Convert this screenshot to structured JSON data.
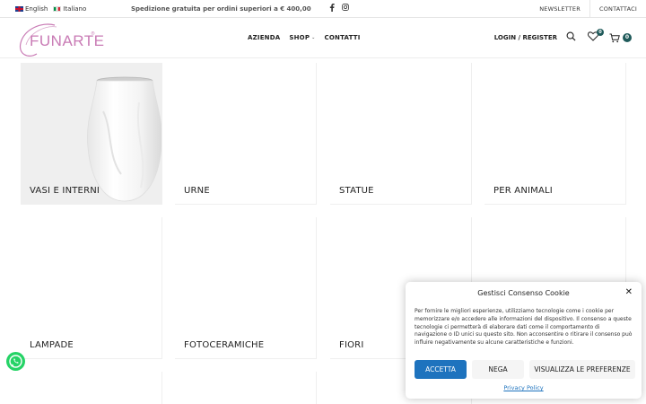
{
  "topbar": {
    "languages": [
      {
        "label": "English",
        "flag": "uk-flag-icon"
      },
      {
        "label": "Italiano",
        "flag": "italy-flag-icon"
      }
    ],
    "shipping_text": "Spedizione gratuita per ordini superiori a € 400,00",
    "social": [
      "facebook-icon",
      "instagram-icon"
    ],
    "links": [
      "NEWSLETTER",
      "CONTATTACI"
    ]
  },
  "header": {
    "logo_text": "FUNARTE",
    "logo_mark": "®",
    "nav": [
      {
        "label": "AZIENDA",
        "dropdown": false
      },
      {
        "label": "SHOP",
        "dropdown": true
      },
      {
        "label": "CONTATTI",
        "dropdown": false
      }
    ],
    "login_label": "LOGIN / REGISTER",
    "wishlist_count": "0",
    "cart_count": "0",
    "accent_color": "#1f5a5a",
    "logo_color": "#c97bb5"
  },
  "categories": [
    {
      "label": "VASI E INTERNI"
    },
    {
      "label": "URNE"
    },
    {
      "label": "STATUE"
    },
    {
      "label": "PER ANIMALI"
    },
    {
      "label": "LAMPADE"
    },
    {
      "label": "FOTOCERAMICHE"
    },
    {
      "label": "FIORI"
    },
    {
      "label": ""
    }
  ],
  "cookie": {
    "title": "Gestisci Consenso Cookie",
    "text": "Per fornire le migliori esperienze, utilizziamo tecnologie come i cookie per memorizzare e/o accedere alle informazioni del dispositivo. Il consenso a queste tecnologie ci permetterà di elaborare dati come il comportamento di navigazione o ID unici su questo sito. Non acconsentire o ritirare il consenso può influire negativamente su alcune caratteristiche e funzioni.",
    "accept_label": "ACCETTA",
    "deny_label": "NEGA",
    "prefs_label": "VISUALIZZA LE PREFERENZE",
    "policy_label": "Privacy Policy",
    "accept_color": "#1e73be"
  }
}
